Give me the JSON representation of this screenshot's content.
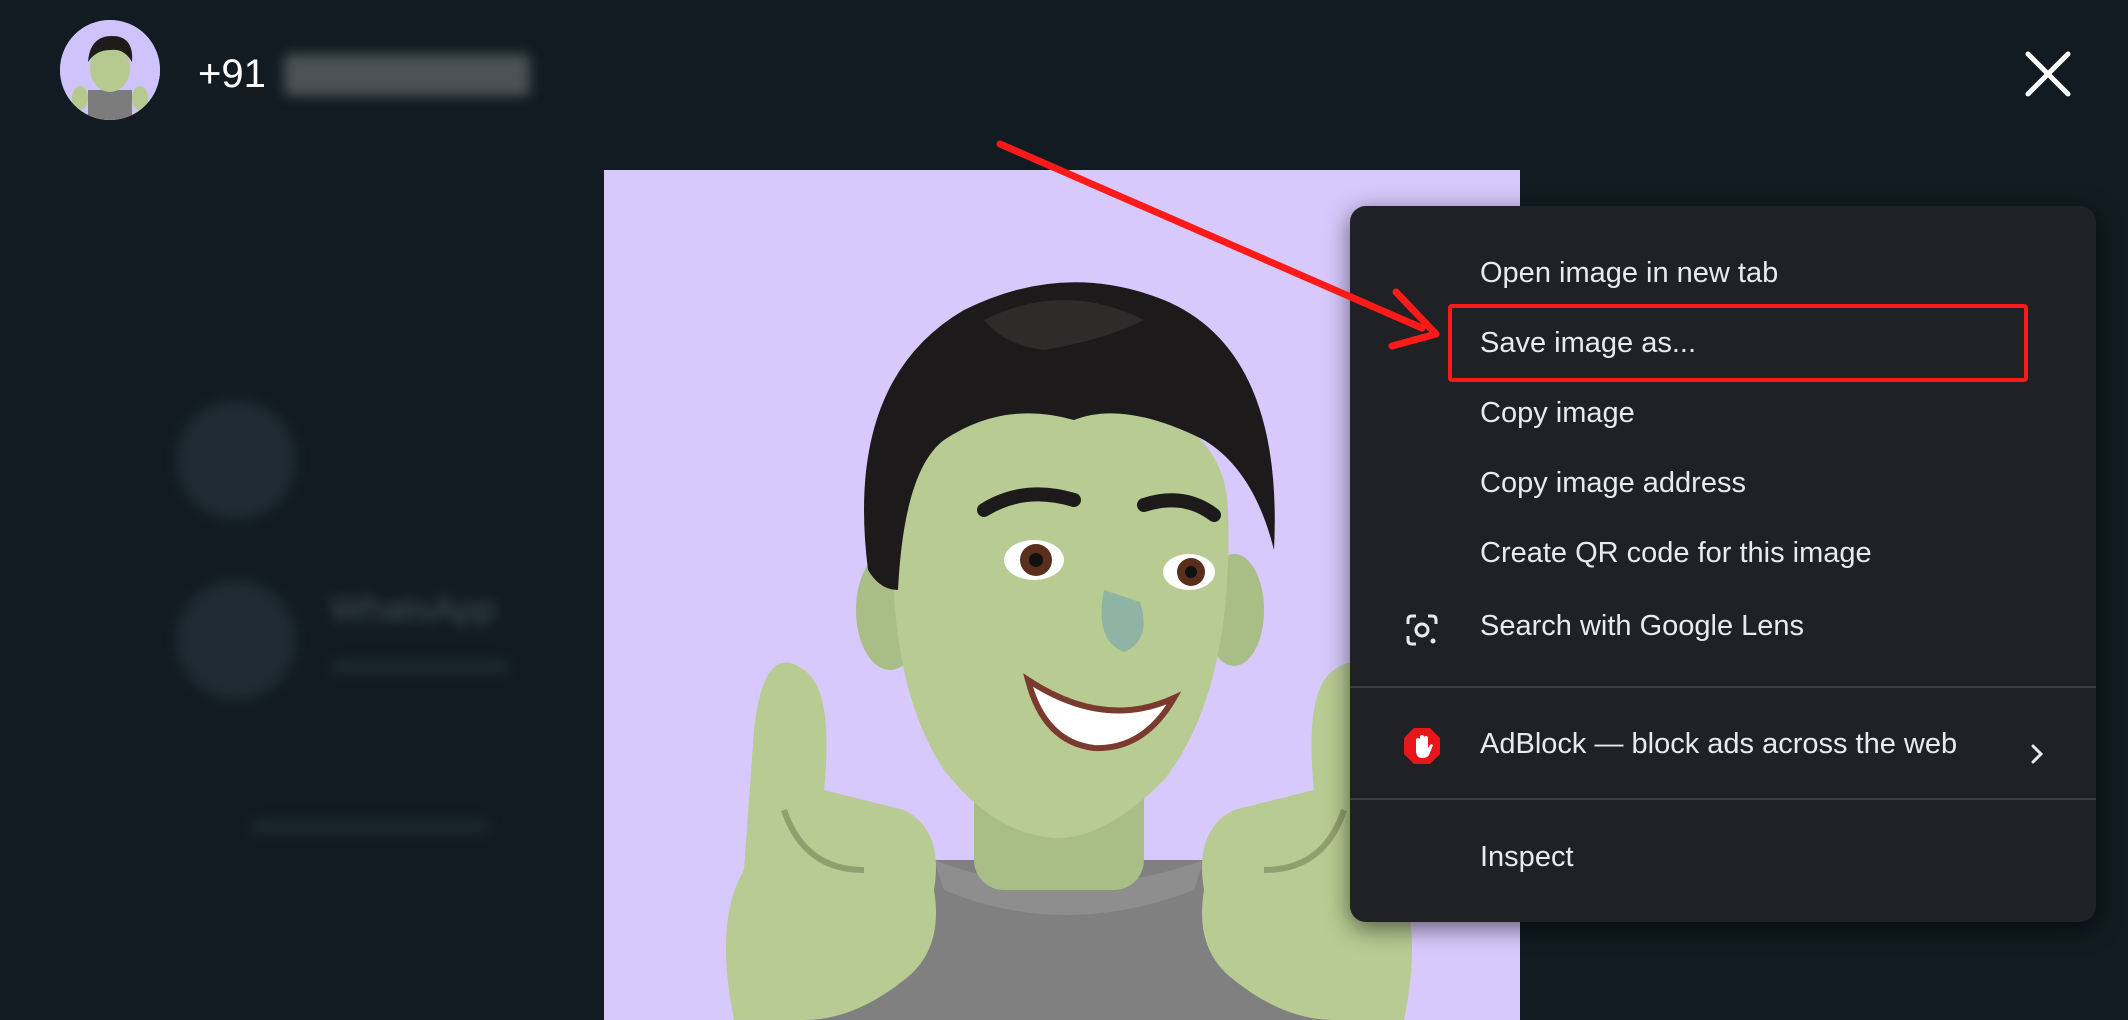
{
  "header": {
    "phone_prefix": "+91",
    "close_icon": "close-icon"
  },
  "background": {
    "blurred_text": "WhatsApp"
  },
  "context_menu": {
    "items": [
      {
        "label": "Open image in new tab",
        "icon": ""
      },
      {
        "label": "Save image as...",
        "icon": "",
        "highlighted": true
      },
      {
        "label": "Copy image",
        "icon": ""
      },
      {
        "label": "Copy image address",
        "icon": ""
      },
      {
        "label": "Create QR code for this image",
        "icon": ""
      },
      {
        "label": "Search with Google Lens",
        "icon": "google-lens-icon"
      },
      {
        "label": "AdBlock — block ads across the web",
        "icon": "adblock-icon",
        "submenu": true
      },
      {
        "label": "Inspect",
        "icon": ""
      }
    ]
  },
  "colors": {
    "background": "#111b21",
    "menu_background": "#202124",
    "menu_text": "#e8eaed",
    "annotation_red": "#ff1a1a",
    "image_background": "#d7c9fb"
  }
}
